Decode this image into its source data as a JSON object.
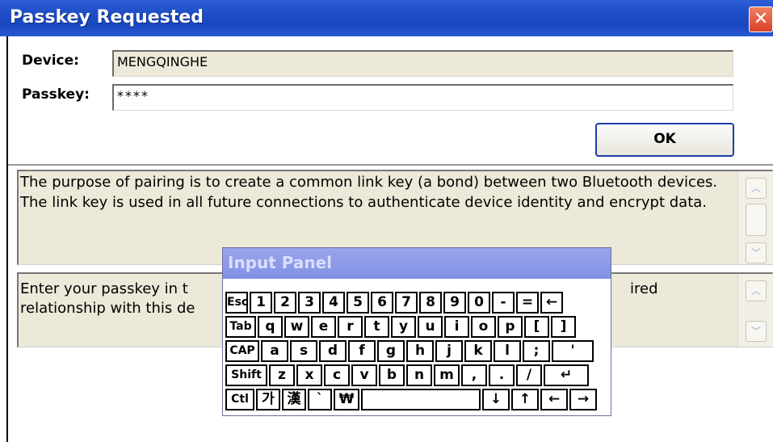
{
  "window": {
    "title": "Passkey Requested",
    "close_glyph": "✕"
  },
  "form": {
    "device_label": "Device:",
    "device_value": "MENGQINGHE",
    "passkey_label": "Passkey:",
    "passkey_value": "****",
    "ok_label": "OK"
  },
  "info_panel": {
    "text": "The purpose of pairing is to create a common link key (a bond) between two Bluetooth devices. The link key is used in all future connections to authenticate device identity and encrypt data."
  },
  "instructions_panel": {
    "text_left": "Enter your passkey in t",
    "text_right": "ired",
    "line2": "relationship with this de"
  },
  "input_panel": {
    "title": "Input Panel",
    "rows": [
      [
        "Esc",
        "1",
        "2",
        "3",
        "4",
        "5",
        "6",
        "7",
        "8",
        "9",
        "0",
        "-",
        "=",
        "←"
      ],
      [
        "Tab",
        "q",
        "w",
        "e",
        "r",
        "t",
        "y",
        "u",
        "i",
        "o",
        "p",
        "[",
        "]"
      ],
      [
        "CAP",
        "a",
        "s",
        "d",
        "f",
        "g",
        "h",
        "j",
        "k",
        "l",
        ";",
        "'"
      ],
      [
        "Shift",
        "z",
        "x",
        "c",
        "v",
        "b",
        "n",
        "m",
        ",",
        ".",
        "/",
        "↵"
      ],
      [
        "Ctl",
        "가",
        "漢",
        "`",
        "₩",
        "",
        "↓",
        "↑",
        "←",
        "→"
      ]
    ]
  },
  "scroll_glyphs": {
    "up": "︿",
    "down": "﹀"
  }
}
